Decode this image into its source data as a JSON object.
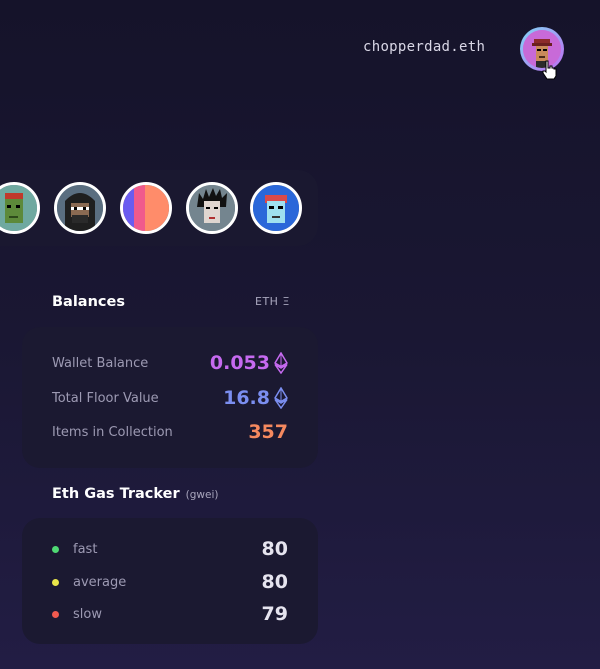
{
  "header": {
    "username": "chopperdad.eth",
    "avatar_icon": "punk-avatar-icon",
    "cursor_icon": "hand-pointer-icon"
  },
  "nfts": [
    {
      "name": "nft-green-punk",
      "bg": "#6fa9a0"
    },
    {
      "name": "nft-hooded-ape",
      "bg": "#5a6e80"
    },
    {
      "name": "nft-orange-blue",
      "bg": "#ff8c6a"
    },
    {
      "name": "nft-wild-hair-punk",
      "bg": "#74858f"
    },
    {
      "name": "nft-blue-punk",
      "bg": "#2a67d9"
    }
  ],
  "balances": {
    "title": "Balances",
    "unit": "ETH Ξ",
    "rows": [
      {
        "label": "Wallet Balance",
        "value": "0.053",
        "color": "#c66af0",
        "eth_icon": true
      },
      {
        "label": "Total Floor Value",
        "value": "16.8",
        "color": "#7b8ef0",
        "eth_icon": true
      },
      {
        "label": "Items in Collection",
        "value": "357",
        "color": "#f5895f",
        "eth_icon": false
      }
    ]
  },
  "gas": {
    "title": "Eth Gas Tracker",
    "unit": "(gwei)",
    "rows": [
      {
        "label": "fast",
        "value": "80",
        "dot_color": "#4fd873"
      },
      {
        "label": "average",
        "value": "80",
        "dot_color": "#e8e54a"
      },
      {
        "label": "slow",
        "value": "79",
        "dot_color": "#f05a4f"
      }
    ]
  }
}
